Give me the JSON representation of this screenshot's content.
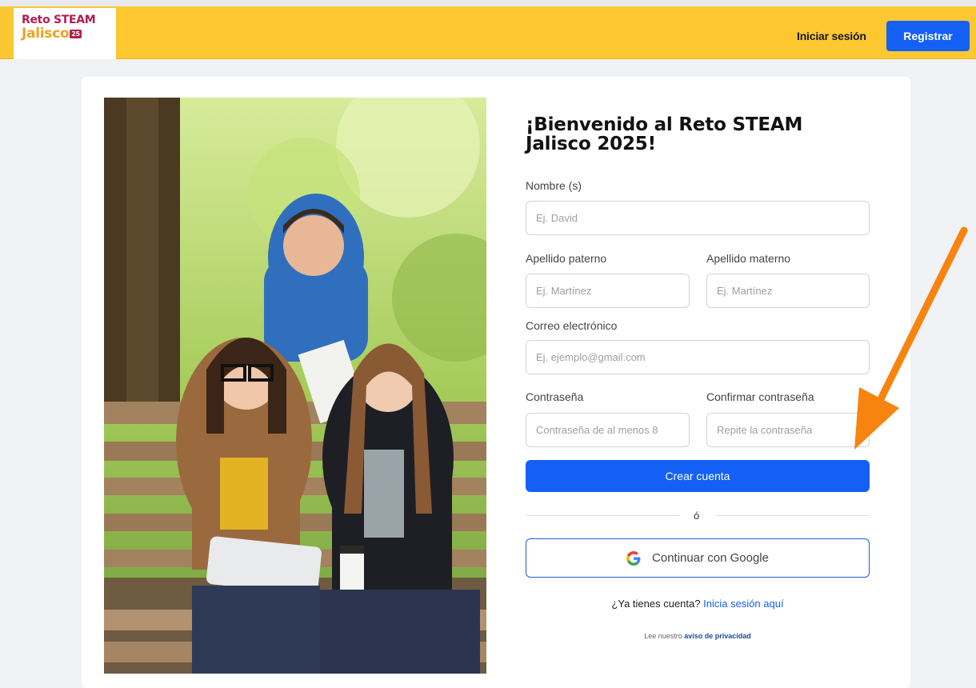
{
  "header": {
    "logo_line1": "Reto STEAM",
    "logo_line2": "Jalisco",
    "logo_badge": "25",
    "login_link": "Iniciar sesión",
    "register_button": "Registrar"
  },
  "form": {
    "title": "¡Bienvenido al Reto STEAM Jalisco 2025!",
    "fields": {
      "nombre": {
        "label": "Nombre (s)",
        "placeholder": "Ej. David"
      },
      "apellido_paterno": {
        "label": "Apellido paterno",
        "placeholder": "Ej. Martínez"
      },
      "apellido_materno": {
        "label": "Apellido materno",
        "placeholder": "Ej. Martínez"
      },
      "correo": {
        "label": "Correo electrónico",
        "placeholder": "Ej. ejemplo@gmail.com"
      },
      "contrasena": {
        "label": "Contraseña",
        "placeholder": "Contraseña de al menos 8"
      },
      "confirmar": {
        "label": "Confirmar contraseña",
        "placeholder": "Repite la contraseña"
      }
    },
    "create_button": "Crear cuenta",
    "or_text": "ó",
    "google_button": "Continuar con Google",
    "have_account_text": "¿Ya tienes cuenta?",
    "login_here_link": "Inicia sesión aquí",
    "privacy_prefix": "Lee nuestro",
    "privacy_link": "aviso de privacidad"
  },
  "icons": {
    "google": "google-g-icon",
    "annotation": "orange-arrow"
  },
  "colors": {
    "header_bg": "#fcc731",
    "primary": "#1460f5",
    "brand_red": "#b01e4f",
    "brand_orange": "#f0a21e",
    "arrow": "#f7840e"
  }
}
